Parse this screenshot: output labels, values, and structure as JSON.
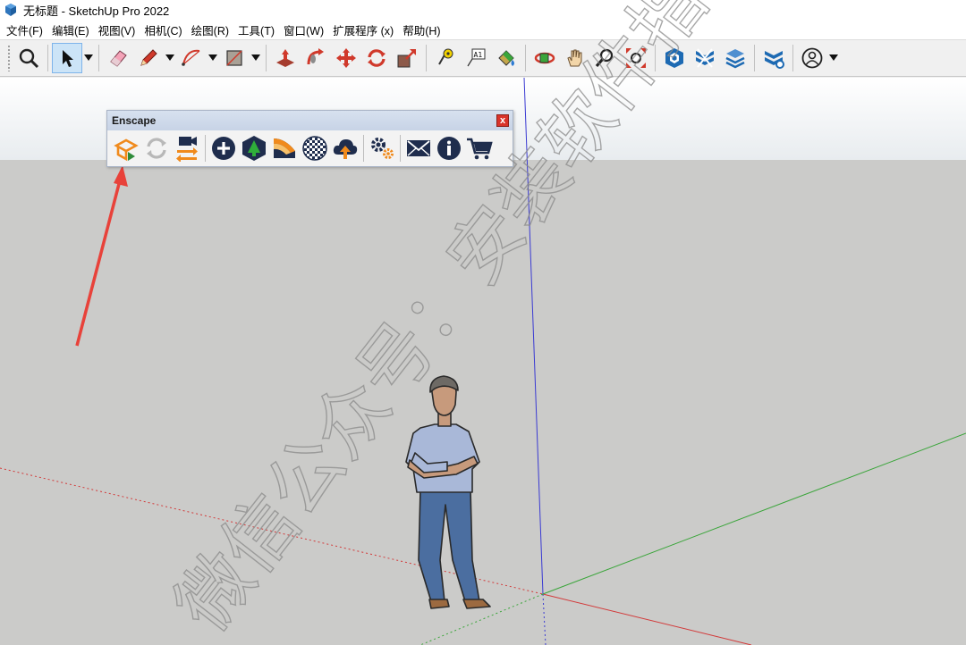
{
  "window": {
    "title": "无标题 - SketchUp Pro 2022",
    "app_icon": "sketchup-logo-icon"
  },
  "menu": {
    "items": [
      {
        "label": "文件(F)"
      },
      {
        "label": "编辑(E)"
      },
      {
        "label": "视图(V)"
      },
      {
        "label": "相机(C)"
      },
      {
        "label": "绘图(R)"
      },
      {
        "label": "工具(T)"
      },
      {
        "label": "窗口(W)"
      },
      {
        "label": "扩展程序 (x)"
      },
      {
        "label": "帮助(H)"
      }
    ]
  },
  "toolbar": {
    "icons": [
      "search-icon",
      "select-arrow-icon",
      "eraser-icon",
      "pencil-icon",
      "arc-icon",
      "rectangle-icon",
      "push-pull-icon",
      "follow-me-icon",
      "move-icon",
      "rotate-icon",
      "scale-icon",
      "tape-measure-icon",
      "text-label-icon",
      "paint-bucket-icon",
      "orbit-icon",
      "pan-icon",
      "zoom-icon",
      "zoom-extents-icon",
      "warehouse-icon",
      "extension-warehouse-icon",
      "layout-icon",
      "extension-manager-icon",
      "account-icon"
    ]
  },
  "enscape": {
    "title": "Enscape",
    "close_label": "x",
    "icons": [
      "start-enscape-icon",
      "live-update-icon",
      "sync-views-icon",
      "video-editor-icon",
      "add-view-icon",
      "asset-library-icon",
      "material-editor-icon",
      "material-sphere-icon",
      "upload-icon",
      "settings-icon",
      "feedback-mail-icon",
      "about-info-icon",
      "shop-cart-icon"
    ]
  },
  "colors": {
    "sky_top": "#ffffff",
    "ground": "#cbcbc9",
    "axis_red": "#d23a3a",
    "axis_green": "#3aa53a",
    "axis_blue": "#3a3ad2",
    "highlight_arrow": "#e8423a",
    "enscape_orange": "#f08a1c"
  },
  "watermark": {
    "text": "微信公众号：安装软件指南"
  }
}
